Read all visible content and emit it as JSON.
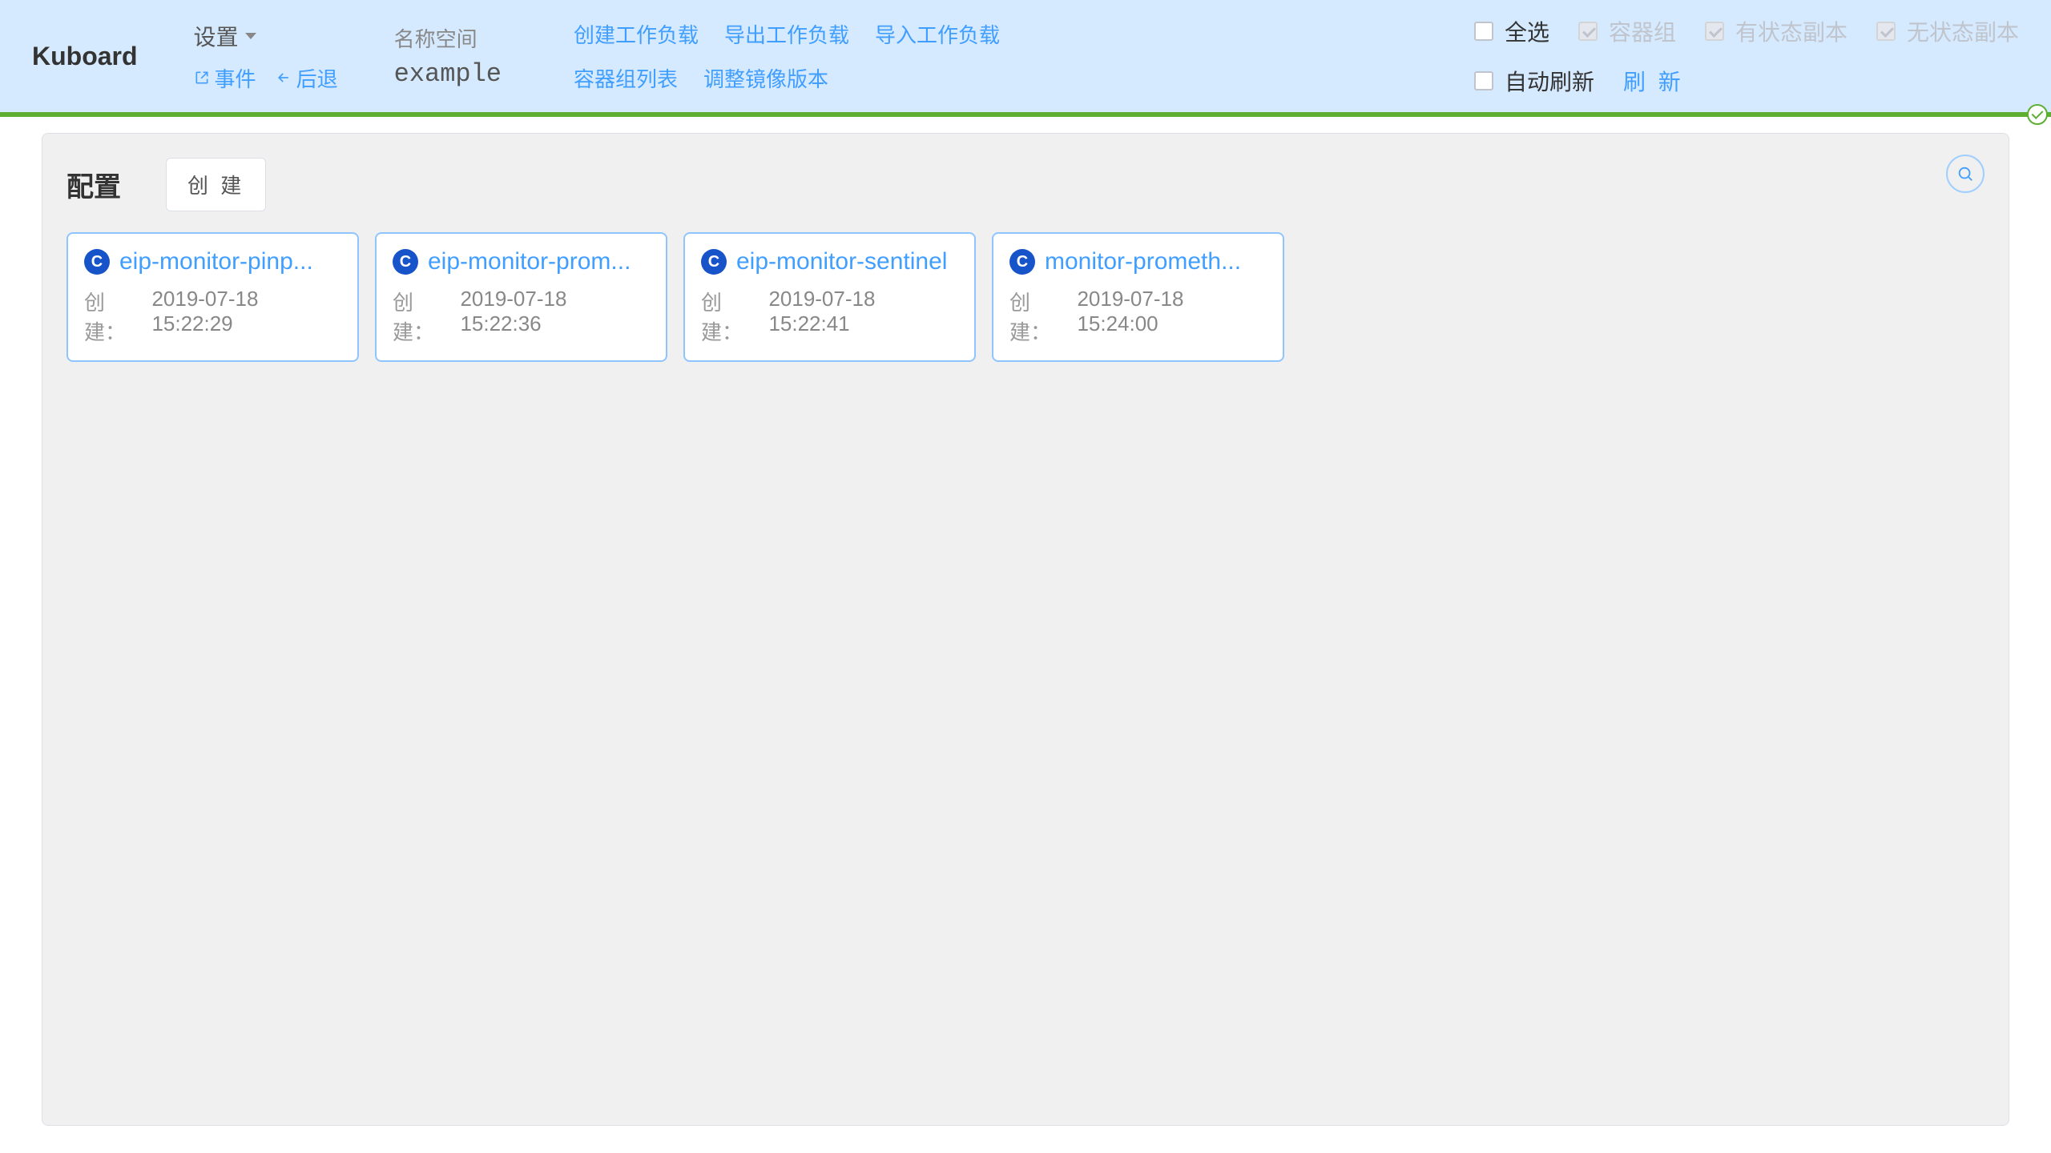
{
  "logo": "Kuboard",
  "header": {
    "settings_label": "设置",
    "events_label": "事件",
    "back_label": "后退",
    "namespace_label": "名称空间",
    "namespace_value": "example",
    "actions": {
      "create_workload": "创建工作负载",
      "export_workload": "导出工作负载",
      "import_workload": "导入工作负载",
      "container_list": "容器组列表",
      "adjust_image": "调整镜像版本"
    },
    "filters": {
      "select_all": "全选",
      "container_group": "容器组",
      "stateful_replica": "有状态副本",
      "stateless_replica": "无状态副本",
      "auto_refresh": "自动刷新",
      "refresh": "刷 新"
    }
  },
  "panel": {
    "title": "配置",
    "create_btn": "创 建",
    "created_label": "创建：",
    "badge_letter": "C",
    "cards": [
      {
        "title": "eip-monitor-pinp...",
        "created": "2019-07-18 15:22:29"
      },
      {
        "title": "eip-monitor-prom...",
        "created": "2019-07-18 15:22:36"
      },
      {
        "title": "eip-monitor-sentinel",
        "created": "2019-07-18 15:22:41"
      },
      {
        "title": "monitor-prometh...",
        "created": "2019-07-18 15:24:00"
      }
    ]
  }
}
